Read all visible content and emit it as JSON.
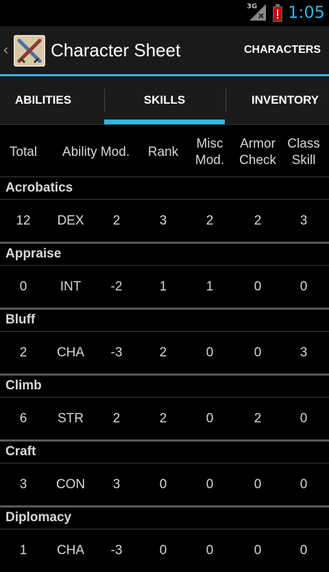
{
  "status_bar": {
    "network": "3G",
    "time": "1:05"
  },
  "action_bar": {
    "title": "Character Sheet",
    "action": "CHARACTERS"
  },
  "tabs": [
    {
      "label": "ABILITIES"
    },
    {
      "label": "SKILLS",
      "selected": true
    },
    {
      "label": "INVENTORY"
    }
  ],
  "columns": {
    "total": "Total",
    "ability_mod": "Ability Mod.",
    "rank": "Rank",
    "misc_mod_line1": "Misc",
    "misc_mod_line2": "Mod.",
    "armor_check_line1": "Armor",
    "armor_check_line2": "Check",
    "class_skill_line1": "Class",
    "class_skill_line2": "Skill"
  },
  "skills": [
    {
      "name": "Acrobatics",
      "total": "12",
      "ability": "DEX",
      "mod": "2",
      "rank": "3",
      "misc": "2",
      "armor": "2",
      "class": "3"
    },
    {
      "name": "Appraise",
      "total": "0",
      "ability": "INT",
      "mod": "-2",
      "rank": "1",
      "misc": "1",
      "armor": "0",
      "class": "0"
    },
    {
      "name": "Bluff",
      "total": "2",
      "ability": "CHA",
      "mod": "-3",
      "rank": "2",
      "misc": "0",
      "armor": "0",
      "class": "3"
    },
    {
      "name": "Climb",
      "total": "6",
      "ability": "STR",
      "mod": "2",
      "rank": "2",
      "misc": "0",
      "armor": "2",
      "class": "0"
    },
    {
      "name": "Craft",
      "total": "3",
      "ability": "CON",
      "mod": "3",
      "rank": "0",
      "misc": "0",
      "armor": "0",
      "class": "0"
    },
    {
      "name": "Diplomacy",
      "total": "1",
      "ability": "CHA",
      "mod": "-3",
      "rank": "0",
      "misc": "0",
      "armor": "0",
      "class": "0"
    }
  ],
  "colors": {
    "accent": "#33b5e5"
  }
}
